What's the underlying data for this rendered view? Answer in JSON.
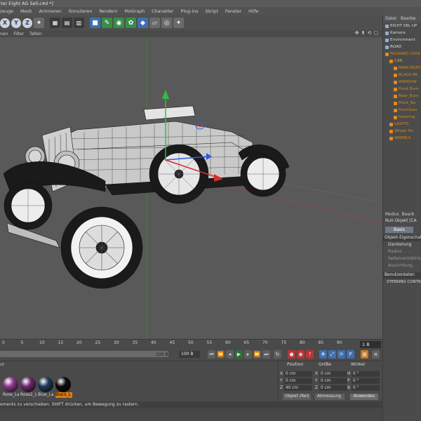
{
  "window": {
    "title": "ter Eight AG Sell.c4d *]"
  },
  "menu": [
    "zeuge",
    "Mesh",
    "Animieren",
    "Simulieren",
    "Rendern",
    "MoGraph",
    "Charakter",
    "Plug-ins",
    "Skript",
    "Fenster",
    "Hilfe"
  ],
  "toolbar": {
    "axis_x": "X",
    "axis_y": "Y",
    "axis_z": "Z"
  },
  "viewport_menu": [
    "nen",
    "Filter",
    "Tafeln"
  ],
  "objects_panel": {
    "tabs": [
      "Datei",
      "Bearbe"
    ],
    "items": [
      {
        "label": "EIGHT SEL UP",
        "indent": 0,
        "state": "normal"
      },
      {
        "label": "Kamera",
        "indent": 0,
        "state": "normal"
      },
      {
        "label": "Environment",
        "indent": 0,
        "state": "normal"
      },
      {
        "label": "ROAD",
        "indent": 0,
        "state": "normal"
      },
      {
        "label": "PACKARD 1929",
        "indent": 0,
        "state": "hl"
      },
      {
        "label": "CAR",
        "indent": 1,
        "state": "sel"
      },
      {
        "label": "MAIN BODY",
        "indent": 2,
        "state": "hl"
      },
      {
        "label": "BLACK PA",
        "indent": 2,
        "state": "hl"
      },
      {
        "label": "WINDOW",
        "indent": 2,
        "state": "hl"
      },
      {
        "label": "Front Bum",
        "indent": 2,
        "state": "hl"
      },
      {
        "label": "Rear_Bum",
        "indent": 2,
        "state": "hl"
      },
      {
        "label": "Front_Ro",
        "indent": 2,
        "state": "hl"
      },
      {
        "label": "FrontGlas",
        "indent": 2,
        "state": "hl"
      },
      {
        "label": "Steering",
        "indent": 2,
        "state": "hl"
      },
      {
        "label": "LIGHTS",
        "indent": 1,
        "state": "hl"
      },
      {
        "label": "Wheel Ho",
        "indent": 1,
        "state": "hl"
      },
      {
        "label": "WHEELS",
        "indent": 1,
        "state": "hl"
      }
    ]
  },
  "attributes": {
    "tabs": [
      "Modus",
      "Bearb"
    ],
    "object_name": "Null-Objekt [CA",
    "basis_tab": "Basis",
    "section": "Objekt-Eigenschaften",
    "rows": [
      {
        "label": "Darstellung",
        "strong": true
      },
      {
        "label": "Radius . . . .",
        "strong": false
      },
      {
        "label": "Seitenverhältnis",
        "strong": false
      },
      {
        "label": "Ausrichtung . .",
        "strong": false
      }
    ],
    "user_data_header": "Benutzerdaten",
    "user_field": "STEERING CONTROL"
  },
  "timeline": {
    "ticks": [
      "0",
      "5",
      "10",
      "15",
      "20",
      "25",
      "30",
      "35",
      "40",
      "45",
      "50",
      "55",
      "60",
      "65",
      "70",
      "75",
      "80",
      "85",
      "90"
    ],
    "current_frame": "1 B",
    "range_end": "100 B",
    "end_frame": "100 B"
  },
  "materials": {
    "menu": "ur",
    "items": [
      {
        "label": "Rose_La",
        "color": "#8a3a8a",
        "selected": false
      },
      {
        "label": "Rose2_L",
        "color": "#6b2a6b",
        "selected": false
      },
      {
        "label": "Blue_La",
        "color": "#1f3a58",
        "selected": false
      },
      {
        "label": "Black_L",
        "color": "#0c0c0c",
        "selected": true
      }
    ]
  },
  "coordinates": {
    "headers": {
      "position": "Position",
      "size": "Größe",
      "rotation": "Winkel"
    },
    "rows": [
      {
        "axis": "X",
        "pos": "0 cm",
        "size_axis": "X",
        "size": "0 cm",
        "rot_axis": "H",
        "rot": "0 °"
      },
      {
        "axis": "Y",
        "pos": "0 cm",
        "size_axis": "Y",
        "size": "0 cm",
        "rot_axis": "P",
        "rot": "0 °"
      },
      {
        "axis": "Z",
        "pos": "40 cm",
        "size_axis": "Z",
        "size": "0 cm",
        "rot_axis": "B",
        "rot": "0 °"
      }
    ],
    "mode_select": "Objekt (Rel)",
    "size_select": "Abmessung",
    "apply": "Anwenden"
  },
  "status": {
    "text": "ements zu verschieben. SHIFT drücken, um Bewegung zu rastern."
  },
  "colors": {
    "axis_x": "#d33030",
    "axis_y": "#2fbf3f",
    "axis_z": "#3058e0",
    "selection_orange": "#e07a10"
  }
}
